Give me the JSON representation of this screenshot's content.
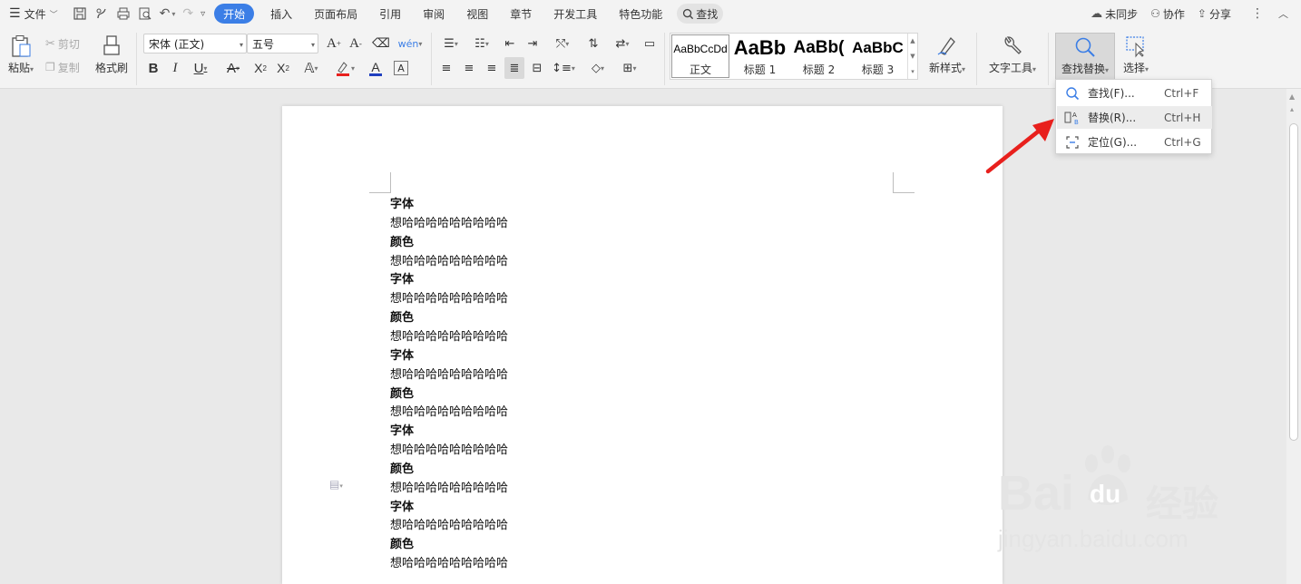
{
  "menubar": {
    "file_label": "文件",
    "tabs": [
      "开始",
      "插入",
      "页面布局",
      "引用",
      "审阅",
      "视图",
      "章节",
      "开发工具",
      "特色功能"
    ],
    "active_tab": "开始",
    "find_label": "查找",
    "sync_label": "未同步",
    "collab_label": "协作",
    "share_label": "分享"
  },
  "ribbon": {
    "paste_label": "粘贴",
    "cut_label": "剪切",
    "copy_label": "复制",
    "format_painter_label": "格式刷",
    "font_name": "宋体 (正文)",
    "font_size": "五号",
    "styles": [
      {
        "preview": "AaBbCcDd",
        "name": "正文"
      },
      {
        "preview": "AaBb",
        "name": "标题 1"
      },
      {
        "preview": "AaBb(",
        "name": "标题 2"
      },
      {
        "preview": "AaBbC",
        "name": "标题 3"
      }
    ],
    "new_style_label": "新样式",
    "text_tools_label": "文字工具",
    "find_replace_label": "查找替换",
    "select_label": "选择"
  },
  "dropdown": {
    "items": [
      {
        "label": "查找(F)...",
        "shortcut": "Ctrl+F"
      },
      {
        "label": "替换(R)...",
        "shortcut": "Ctrl+H"
      },
      {
        "label": "定位(G)...",
        "shortcut": "Ctrl+G"
      }
    ]
  },
  "document": {
    "lines": [
      {
        "text": "字体",
        "bold": true
      },
      {
        "text": "想哈哈哈哈哈哈哈哈哈",
        "bold": false
      },
      {
        "text": "颜色",
        "bold": true
      },
      {
        "text": "想哈哈哈哈哈哈哈哈哈",
        "bold": false
      },
      {
        "text": "字体",
        "bold": true
      },
      {
        "text": "想哈哈哈哈哈哈哈哈哈",
        "bold": false
      },
      {
        "text": "颜色",
        "bold": true
      },
      {
        "text": "想哈哈哈哈哈哈哈哈哈",
        "bold": false
      },
      {
        "text": "字体",
        "bold": true
      },
      {
        "text": "想哈哈哈哈哈哈哈哈哈",
        "bold": false
      },
      {
        "text": "颜色",
        "bold": true
      },
      {
        "text": "想哈哈哈哈哈哈哈哈哈",
        "bold": false
      },
      {
        "text": "字体",
        "bold": true
      },
      {
        "text": "想哈哈哈哈哈哈哈哈哈",
        "bold": false
      },
      {
        "text": "颜色",
        "bold": true
      },
      {
        "text": "想哈哈哈哈哈哈哈哈哈",
        "bold": false
      },
      {
        "text": "字体",
        "bold": true
      },
      {
        "text": "想哈哈哈哈哈哈哈哈哈",
        "bold": false
      },
      {
        "text": "颜色",
        "bold": true
      },
      {
        "text": "想哈哈哈哈哈哈哈哈哈",
        "bold": false
      }
    ]
  },
  "watermark": {
    "brand": "Bai",
    "brand2": "du",
    "cn": "经验",
    "url": "jingyan.baidu.com"
  },
  "colors": {
    "accent": "#3b7ee6",
    "arrow": "#e8201d",
    "font_color": "#1f3fbf",
    "highlight": "#e8201d"
  }
}
